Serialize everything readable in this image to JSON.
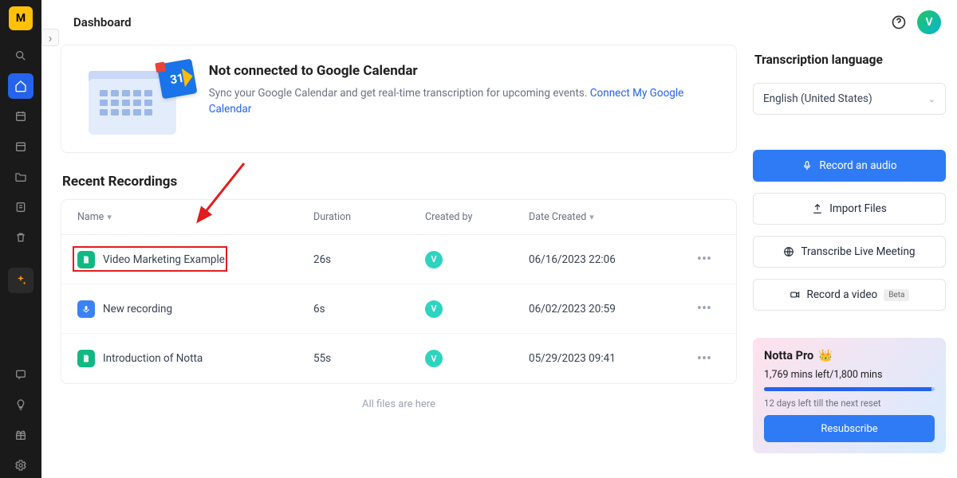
{
  "brand_letter": "M",
  "header": {
    "title": "Dashboard",
    "avatar_letter": "V"
  },
  "banner": {
    "title": "Not connected to Google Calendar",
    "desc": "Sync your Google Calendar and get real-time transcription for upcoming events. ",
    "link": "Connect My Google Calendar",
    "gcal_day": "31"
  },
  "recent": {
    "title": "Recent Recordings",
    "cols": {
      "name": "Name",
      "duration": "Duration",
      "created_by": "Created by",
      "date": "Date Created"
    },
    "rows": [
      {
        "name": "Video Marketing Example",
        "duration": "26s",
        "creator": "V",
        "date": "06/16/2023 22:06",
        "icon": "green",
        "highlight": true
      },
      {
        "name": "New recording",
        "duration": "6s",
        "creator": "V",
        "date": "06/02/2023 20:59",
        "icon": "blue"
      },
      {
        "name": "Introduction of Notta",
        "duration": "55s",
        "creator": "V",
        "date": "05/29/2023 09:41",
        "icon": "green"
      }
    ],
    "footer": "All files are here"
  },
  "side": {
    "lang_title": "Transcription language",
    "lang_value": "English (United States)",
    "record": "Record an audio",
    "import": "Import Files",
    "live": "Transcribe Live Meeting",
    "video": "Record a video",
    "beta": "Beta"
  },
  "pro": {
    "title": "Notta Pro",
    "mins": "1,769 mins left/1,800 mins",
    "days": "12 days left till the next reset",
    "resub": "Resubscribe"
  }
}
